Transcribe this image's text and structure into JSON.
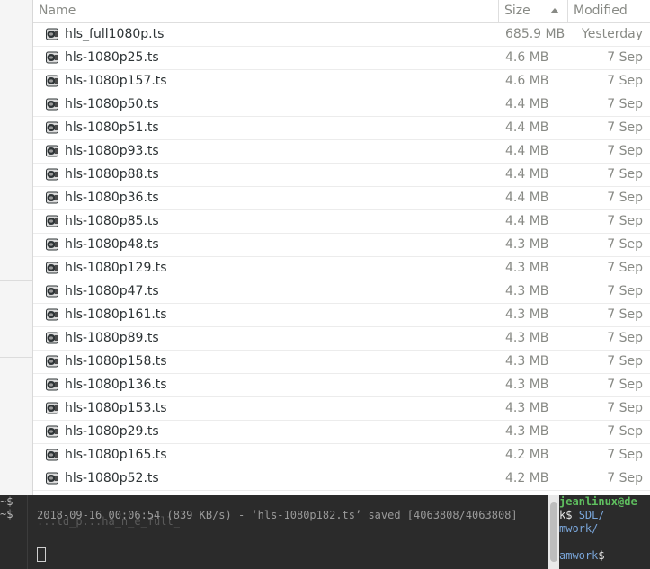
{
  "file_list": {
    "columns": {
      "name": "Name",
      "size": "Size",
      "modified": "Modified"
    },
    "sort": {
      "column": "size",
      "direction": "descending"
    },
    "rows": [
      {
        "name": "hls_full1080p.ts",
        "size": "685.9 MB",
        "modified": "Yesterday"
      },
      {
        "name": "hls-1080p25.ts",
        "size": "4.6 MB",
        "modified": "7 Sep"
      },
      {
        "name": "hls-1080p157.ts",
        "size": "4.6 MB",
        "modified": "7 Sep"
      },
      {
        "name": "hls-1080p50.ts",
        "size": "4.4 MB",
        "modified": "7 Sep"
      },
      {
        "name": "hls-1080p51.ts",
        "size": "4.4 MB",
        "modified": "7 Sep"
      },
      {
        "name": "hls-1080p93.ts",
        "size": "4.4 MB",
        "modified": "7 Sep"
      },
      {
        "name": "hls-1080p88.ts",
        "size": "4.4 MB",
        "modified": "7 Sep"
      },
      {
        "name": "hls-1080p36.ts",
        "size": "4.4 MB",
        "modified": "7 Sep"
      },
      {
        "name": "hls-1080p85.ts",
        "size": "4.4 MB",
        "modified": "7 Sep"
      },
      {
        "name": "hls-1080p48.ts",
        "size": "4.3 MB",
        "modified": "7 Sep"
      },
      {
        "name": "hls-1080p129.ts",
        "size": "4.3 MB",
        "modified": "7 Sep"
      },
      {
        "name": "hls-1080p47.ts",
        "size": "4.3 MB",
        "modified": "7 Sep"
      },
      {
        "name": "hls-1080p161.ts",
        "size": "4.3 MB",
        "modified": "7 Sep"
      },
      {
        "name": "hls-1080p89.ts",
        "size": "4.3 MB",
        "modified": "7 Sep"
      },
      {
        "name": "hls-1080p158.ts",
        "size": "4.3 MB",
        "modified": "7 Sep"
      },
      {
        "name": "hls-1080p136.ts",
        "size": "4.3 MB",
        "modified": "7 Sep"
      },
      {
        "name": "hls-1080p153.ts",
        "size": "4.3 MB",
        "modified": "7 Sep"
      },
      {
        "name": "hls-1080p29.ts",
        "size": "4.3 MB",
        "modified": "7 Sep"
      },
      {
        "name": "hls-1080p165.ts",
        "size": "4.2 MB",
        "modified": "7 Sep"
      },
      {
        "name": "hls-1080p52.ts",
        "size": "4.2 MB",
        "modified": "7 Sep"
      }
    ],
    "file_icon": "video-file-icon"
  },
  "terminals": {
    "left": {
      "lines": [
        "~$",
        "~$"
      ]
    },
    "middle": {
      "ghost_text": "...ld_p...ha_n_e_full_",
      "output": "2018-09-16 00:06:54 (839 KB/s) - ‘hls-1080p182.ts’ saved [4063808/4063808]"
    },
    "right": {
      "line1": "jeanlinux@de",
      "line2_prefix": "k$ ",
      "line2_path": "SDL/",
      "line3": "mwork/",
      "line5_path": "amwork",
      "line5_suffix": "$"
    }
  },
  "colors": {
    "accent_green": "#5fbf5f",
    "path_blue": "#7aa6da"
  }
}
